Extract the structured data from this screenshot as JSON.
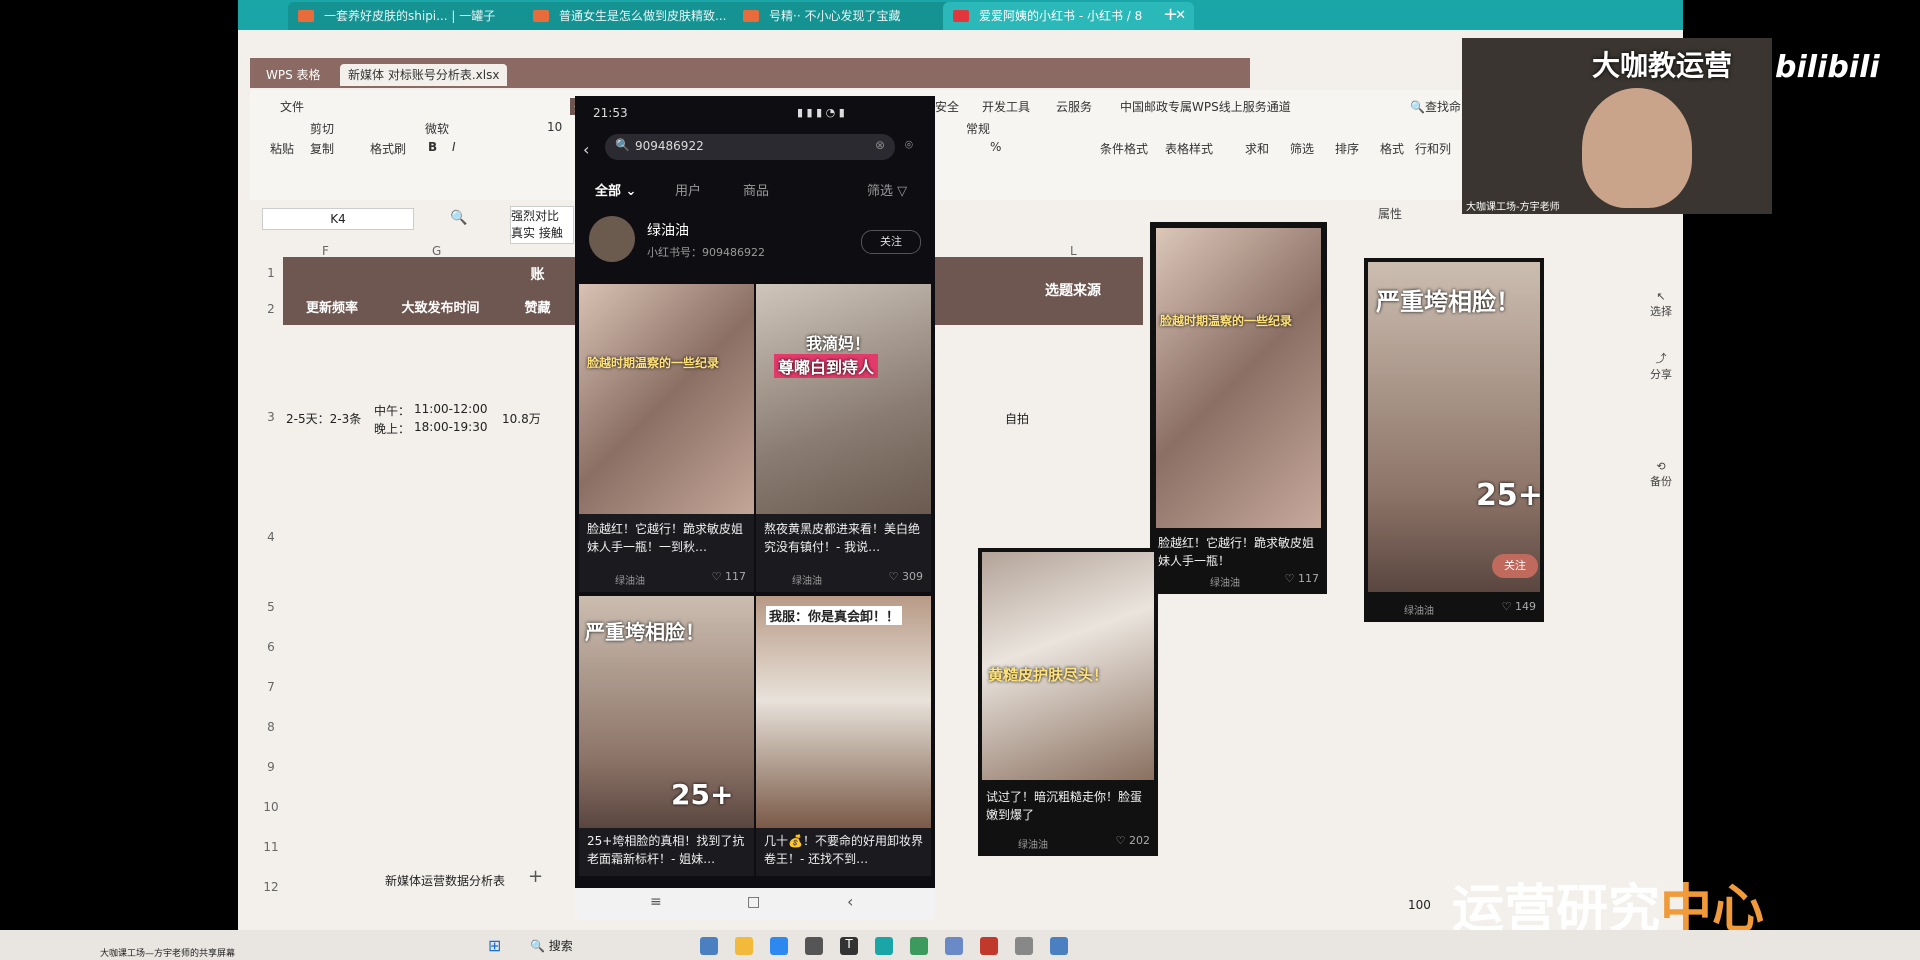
{
  "browser": {
    "tabs": [
      {
        "label": "一套养好皮肤的shipi... | 一罐子"
      },
      {
        "label": "普通女生是怎么做到皮肤精致..."
      },
      {
        "label": "号精·· 不小心发现了宝藏"
      },
      {
        "label": "爱爱阿姨的小红书 - 小红书 / 8"
      }
    ],
    "new_tab": "+"
  },
  "wps": {
    "app_tab": "WPS 表格",
    "file_tab": "新媒体 对标账号分析表.xlsx",
    "menu": [
      "文件",
      "开",
      "安全",
      "开发工具",
      "云服务",
      "中国邮政专属WPS线上服务通道"
    ],
    "search": "查找命",
    "ribbon": {
      "paste": "粘贴",
      "cut": "剪切",
      "copy": "复制",
      "format_painter": "格式刷",
      "font": "微软",
      "size": "10",
      "bold": "B",
      "italic": "I",
      "style": "常规",
      "cond_format": "条件格式",
      "table_style": "表格样式",
      "sum": "求和",
      "filter": "筛选",
      "sort": "排序",
      "format": "格式",
      "rowcol": "行和列",
      "percent": "%"
    },
    "name_box": "K4",
    "formula_text": "强烈对比\n真实 接触",
    "properties": "属性",
    "columns": [
      "F",
      "G",
      "L"
    ],
    "rows": [
      "1",
      "2",
      "3",
      "4",
      "5",
      "6",
      "7",
      "8",
      "9",
      "10",
      "11",
      "12"
    ],
    "header_row2": [
      "更新频率",
      "大致发布时间",
      "赞藏"
    ],
    "header_row1": [
      "账"
    ],
    "topic_header": "选题来源",
    "row3": {
      "freq": "2-5天：2-3条",
      "time_label1": "中午：",
      "time1": "11:00-12:00",
      "time_label2": "晚上：",
      "time2": "18:00-19:30",
      "likes": "10.8万",
      "topic": "自拍"
    },
    "sheet_tab": "新媒体运营数据分析表",
    "sidebar": [
      "选择",
      "分享",
      "备份"
    ],
    "zoom": "100"
  },
  "phone": {
    "time": "21:53",
    "search_query": "909486922",
    "filters": [
      "全部",
      "用户",
      "商品",
      "筛选"
    ],
    "account": {
      "name": "绿油油",
      "id": "小红书号：909486922",
      "follow": "关注"
    },
    "cards": [
      {
        "overlay": "脸越时期温察的一些纪录",
        "title": "脸越红！它越行！跪求敏皮姐妹人手一瓶！一到秋…",
        "author": "绿油油",
        "likes": "117"
      },
      {
        "overlay": "我滴妈！",
        "overlay2": "尊嘟白到痔人",
        "title": "熬夜黄黑皮都进来看！美白绝究没有镇付！- 我说…",
        "author": "绿油油",
        "likes": "309"
      },
      {
        "overlay": "严重垮相脸！",
        "badge": "25+",
        "title": "25+垮相脸的真相！找到了抗老面霜新标杆！- 姐妹…",
        "author": "绿油油",
        "likes": ""
      },
      {
        "overlay": "我服：你是真会卸！！",
        "title": "几十💰！不要命的好用卸妆界卷王！- 还找不到…",
        "author": "绿油油",
        "likes": ""
      }
    ],
    "nav": [
      "≡",
      "□",
      "‹"
    ]
  },
  "floats": [
    {
      "overlay": "脸越时期温察的一些纪录",
      "title": "脸越红！它越行！跪求敏皮姐妹人手一瓶！",
      "author": "绿油油",
      "likes": "117"
    },
    {
      "overlay": "严重垮相脸！",
      "badge": "25+",
      "author": "绿油油",
      "likes": "149",
      "button": "关注"
    },
    {
      "overlay": "黄糙皮护肤尽头！",
      "title": "试过了！暗沉粗糙走你！脸蛋嫩到爆了",
      "author": "绿油油",
      "likes": "202"
    }
  ],
  "webcam": {
    "title": "大咖教运营",
    "caption": "大咖课工场-方宇老师"
  },
  "watermark": {
    "bilibili": "bilibili",
    "brand1": "运营研究",
    "brand2": "中心"
  },
  "taskbar": {
    "search": "搜索",
    "bottom_caption": "大咖课工场—方宇老师的共享屏幕"
  },
  "colors": {
    "teal": "#1aa6a6",
    "header_brown": "#6e5750",
    "brand_white": "#ffffff",
    "brand_orange": "#f09a3a"
  }
}
